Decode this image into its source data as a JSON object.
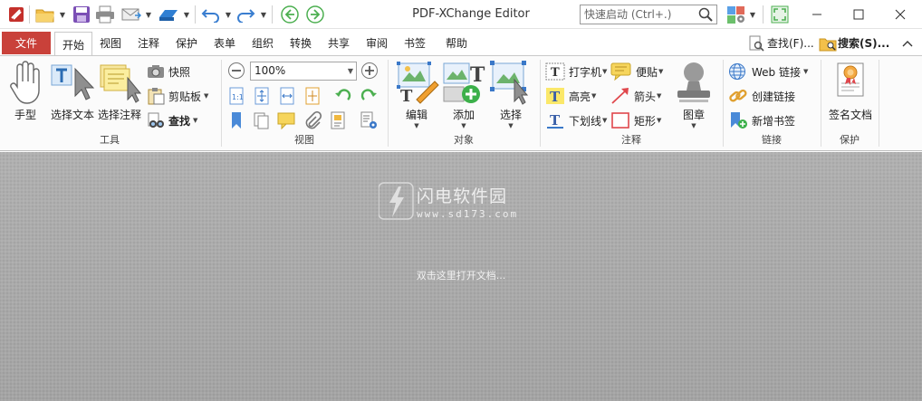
{
  "app": {
    "title": "PDF-XChange Editor"
  },
  "quick_launch": {
    "placeholder": "快速启动 (Ctrl+.)"
  },
  "menu": {
    "file": "文件",
    "tabs": [
      "开始",
      "视图",
      "注释",
      "保护",
      "表单",
      "组织",
      "转换",
      "共享",
      "审阅",
      "书签",
      "帮助"
    ],
    "find_label": "查找(F)...",
    "search_label": "搜索(S)..."
  },
  "ribbon": {
    "tools": {
      "label": "工具",
      "hand": "手型",
      "select_text": "选择文本",
      "select_annot": "选择注释",
      "snapshot": "快照",
      "clipboard": "剪贴板",
      "find": "查找"
    },
    "view": {
      "label": "视图",
      "zoom_value": "100%"
    },
    "objects": {
      "label": "对象",
      "edit": "编辑",
      "add": "添加",
      "select": "选择"
    },
    "comment": {
      "label": "注释",
      "typewriter": "打字机",
      "sticky_note": "便贴",
      "highlight": "高亮",
      "arrow": "箭头",
      "underline": "下划线",
      "rectangle": "矩形",
      "stamp": "图章"
    },
    "links": {
      "label": "链接",
      "web_link": "Web 链接",
      "create_link": "创建链接",
      "add_bookmark": "新增书签"
    },
    "protect": {
      "label": "保护",
      "sign_doc": "签名文档"
    }
  },
  "document": {
    "hint": "双击这里打开文档...",
    "watermark_title": "闪电软件园",
    "watermark_url": "www.sd173.com"
  },
  "colors": {
    "file_tab": "#c9413a",
    "doc_bg": "#a8a8a8"
  }
}
